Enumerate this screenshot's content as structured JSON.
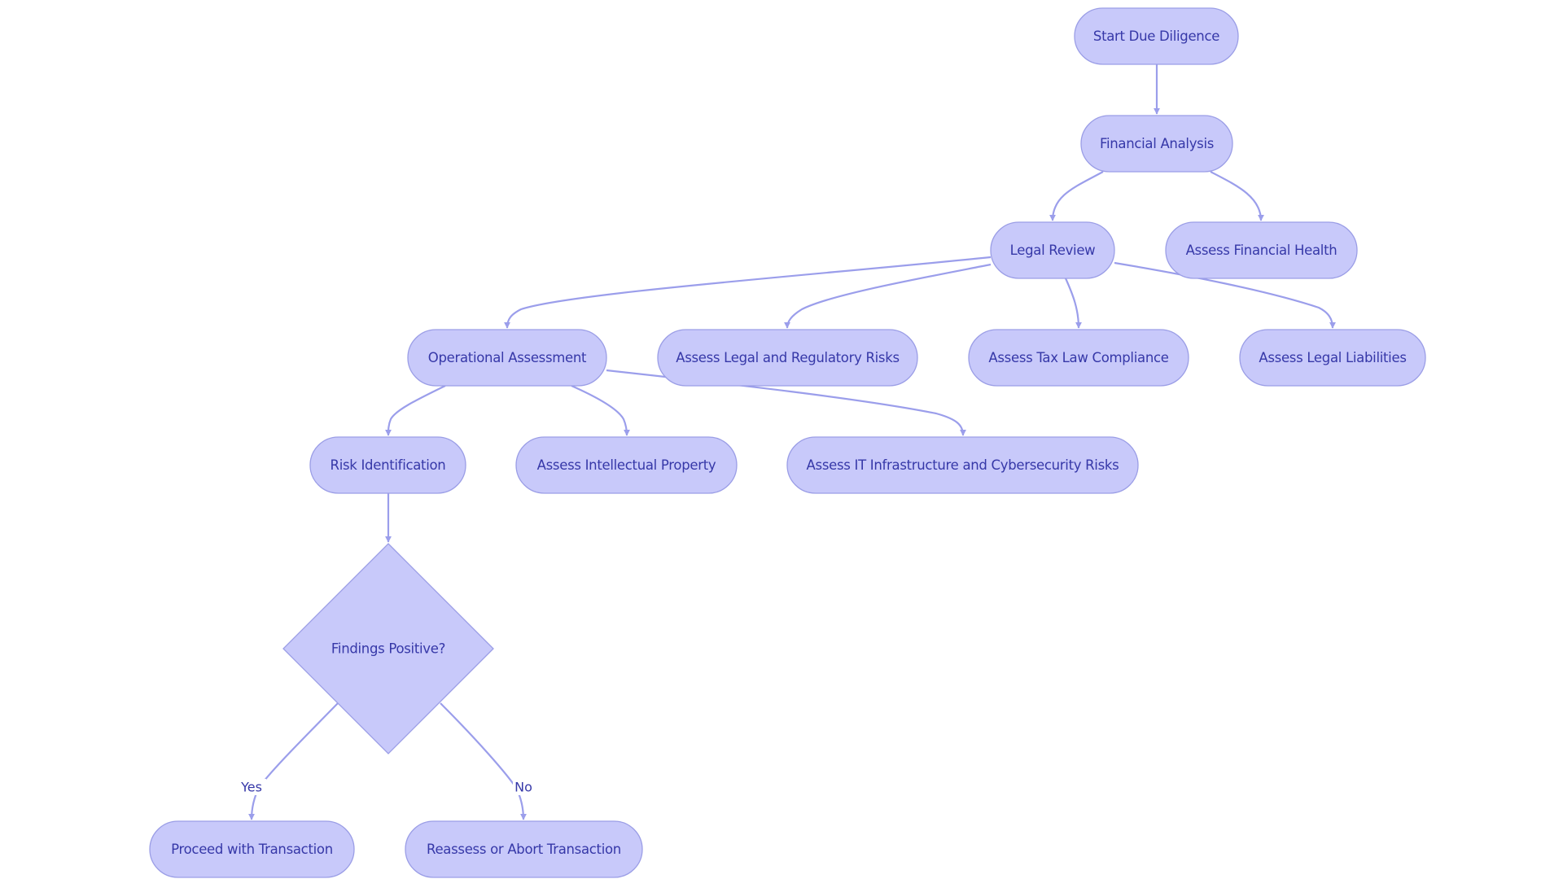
{
  "diagram": {
    "type": "flowchart",
    "colors": {
      "node_fill": "#c8c9fa",
      "node_stroke": "#9b9ee6",
      "edge": "#9b9eeb",
      "text": "#3638a8",
      "background": "#ffffff"
    },
    "nodes": [
      {
        "id": "start",
        "label": "Start Due Diligence",
        "shape": "stadium"
      },
      {
        "id": "financial",
        "label": "Financial Analysis",
        "shape": "stadium"
      },
      {
        "id": "legal",
        "label": "Legal Review",
        "shape": "stadium"
      },
      {
        "id": "fin_health",
        "label": "Assess Financial Health",
        "shape": "stadium"
      },
      {
        "id": "operational",
        "label": "Operational Assessment",
        "shape": "stadium"
      },
      {
        "id": "legal_reg",
        "label": "Assess Legal and Regulatory Risks",
        "shape": "stadium"
      },
      {
        "id": "tax",
        "label": "Assess Tax Law Compliance",
        "shape": "stadium"
      },
      {
        "id": "liabilities",
        "label": "Assess Legal Liabilities",
        "shape": "stadium"
      },
      {
        "id": "risk",
        "label": "Risk Identification",
        "shape": "stadium"
      },
      {
        "id": "ip",
        "label": "Assess Intellectual Property",
        "shape": "stadium"
      },
      {
        "id": "it",
        "label": "Assess IT Infrastructure and Cybersecurity Risks",
        "shape": "stadium"
      },
      {
        "id": "decision",
        "label": "Findings Positive?",
        "shape": "diamond"
      },
      {
        "id": "proceed",
        "label": "Proceed with Transaction",
        "shape": "stadium"
      },
      {
        "id": "reassess",
        "label": "Reassess or Abort Transaction",
        "shape": "stadium"
      }
    ],
    "edges": [
      {
        "from": "start",
        "to": "financial",
        "label": ""
      },
      {
        "from": "financial",
        "to": "legal",
        "label": ""
      },
      {
        "from": "financial",
        "to": "fin_health",
        "label": ""
      },
      {
        "from": "legal",
        "to": "operational",
        "label": ""
      },
      {
        "from": "legal",
        "to": "legal_reg",
        "label": ""
      },
      {
        "from": "legal",
        "to": "tax",
        "label": ""
      },
      {
        "from": "legal",
        "to": "liabilities",
        "label": ""
      },
      {
        "from": "operational",
        "to": "risk",
        "label": ""
      },
      {
        "from": "operational",
        "to": "ip",
        "label": ""
      },
      {
        "from": "operational",
        "to": "it",
        "label": ""
      },
      {
        "from": "risk",
        "to": "decision",
        "label": ""
      },
      {
        "from": "decision",
        "to": "proceed",
        "label": "Yes"
      },
      {
        "from": "decision",
        "to": "reassess",
        "label": "No"
      }
    ]
  }
}
